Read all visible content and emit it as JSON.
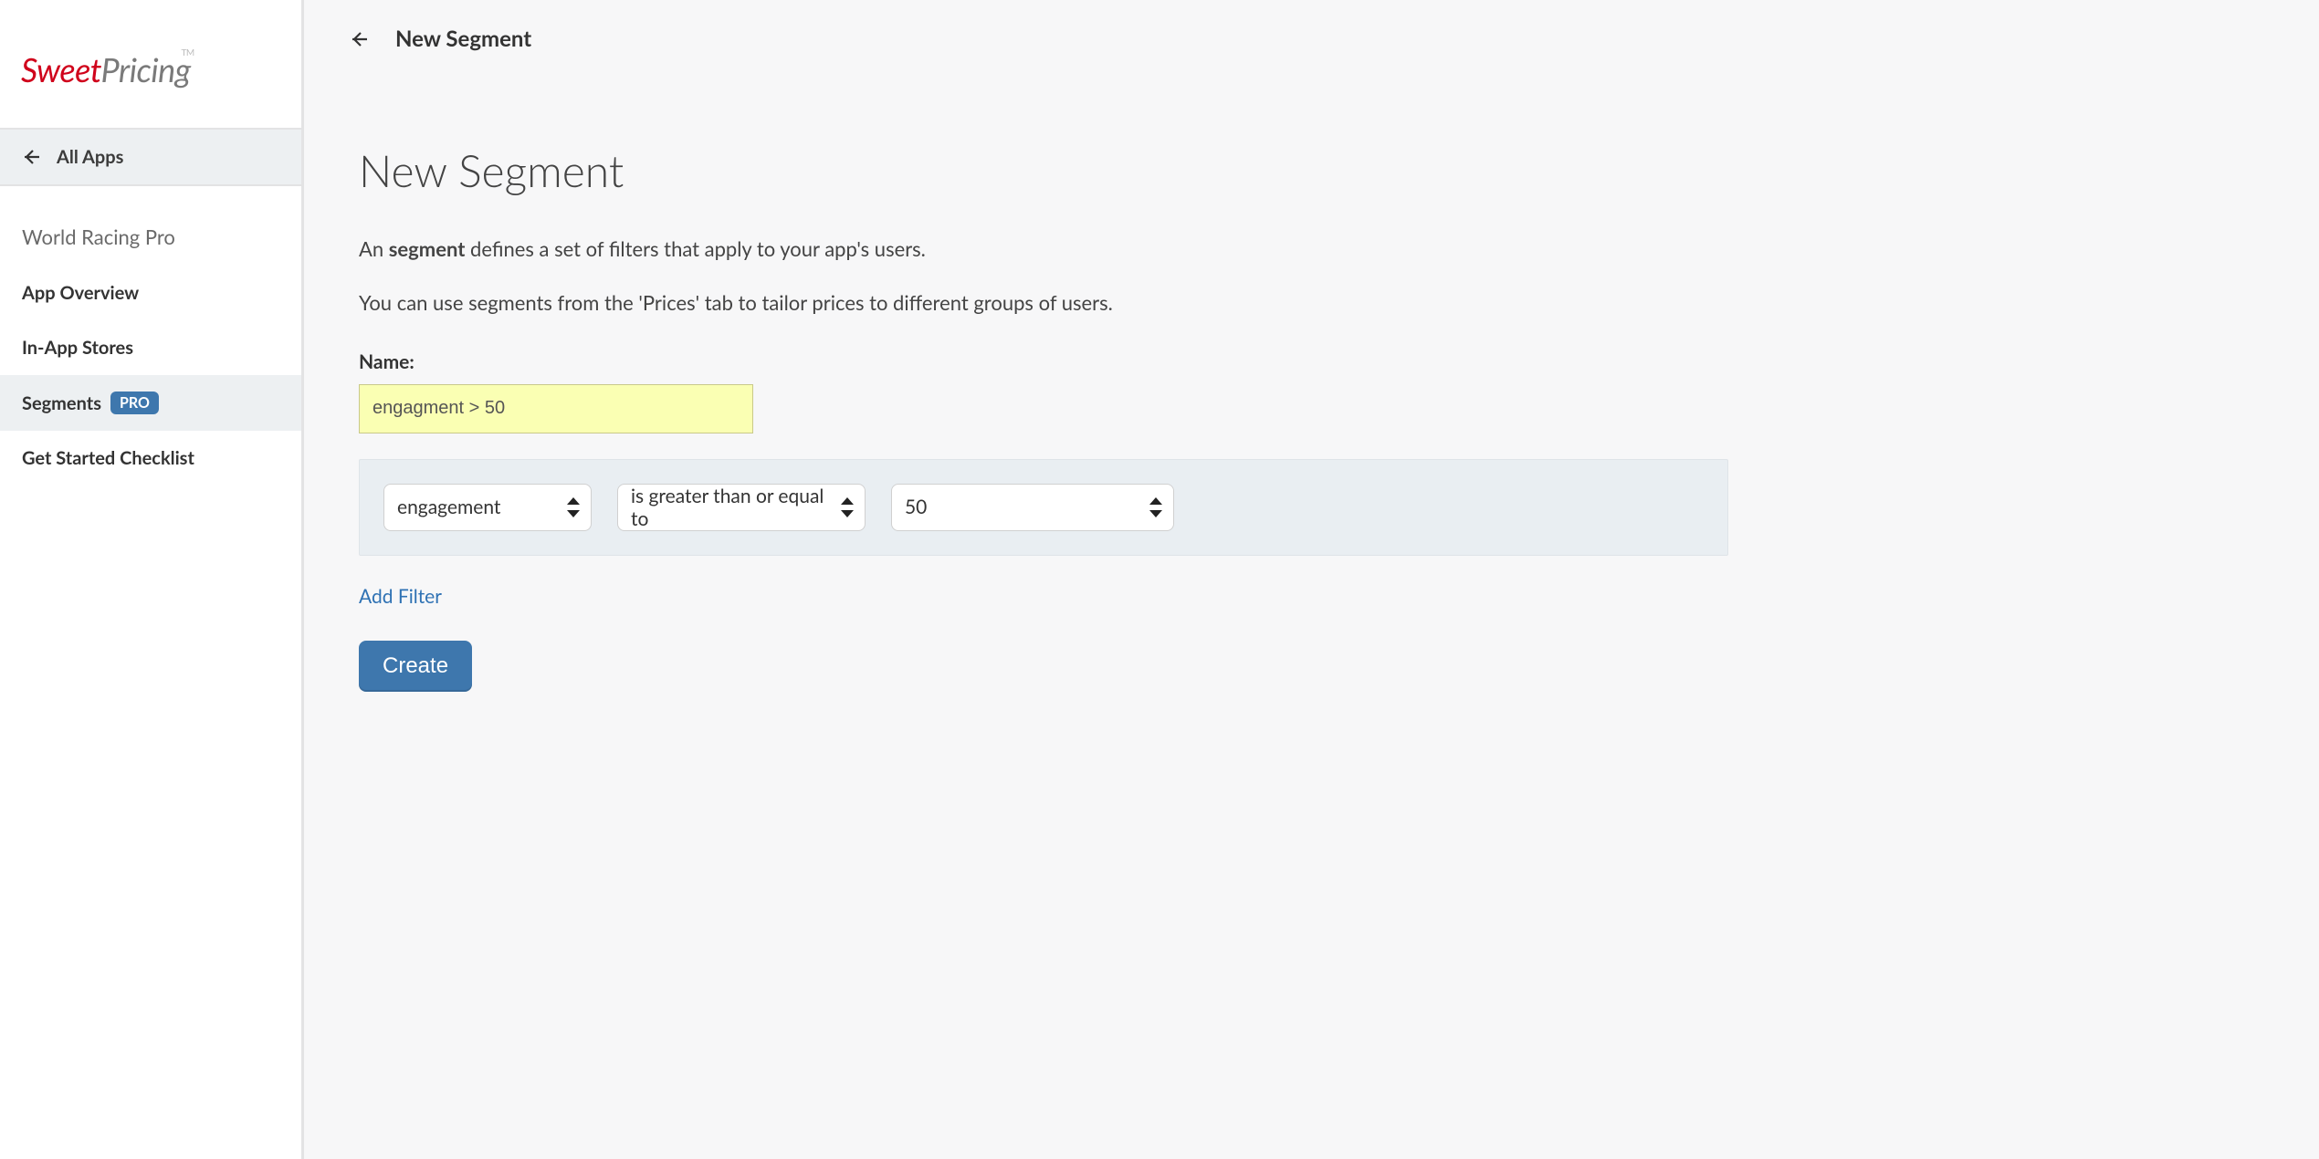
{
  "brand": {
    "word1": "Sweet",
    "word2": "Pricing",
    "tm": "TM"
  },
  "sidebar": {
    "all_apps_label": "All Apps",
    "app_name": "World Racing Pro",
    "items": [
      {
        "label": "App Overview"
      },
      {
        "label": "In-App Stores"
      },
      {
        "label": "Segments",
        "badge": "PRO",
        "selected": true
      },
      {
        "label": "Get Started Checklist"
      }
    ]
  },
  "header": {
    "title": "New Segment"
  },
  "page": {
    "heading": "New Segment",
    "desc1_pre": "An ",
    "desc1_bold": "segment",
    "desc1_post": " defines a set of filters that apply to your app's users.",
    "desc2": "You can use segments from the 'Prices' tab to tailor prices to different groups of users.",
    "form": {
      "name_label": "Name:",
      "name_value": "engagment > 50",
      "filter": {
        "field": "engagement",
        "operator": "is greater than or equal to",
        "value": "50"
      },
      "add_filter_label": "Add Filter",
      "submit_label": "Create"
    }
  }
}
